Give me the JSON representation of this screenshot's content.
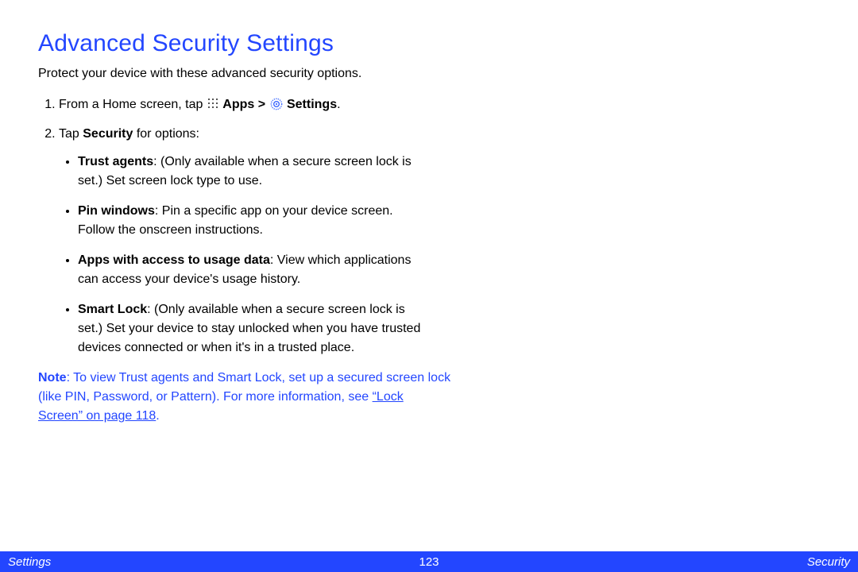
{
  "title": "Advanced Security Settings",
  "intro": "Protect your device with these advanced security options.",
  "step1": {
    "prefix": "From a Home screen, tap ",
    "apps_label": "Apps",
    "sep": " > ",
    "settings_label": "Settings",
    "suffix": "."
  },
  "step2": {
    "prefix": "Tap ",
    "bold": "Security",
    "suffix": " for options:",
    "items": [
      {
        "label": "Trust agents",
        "desc": ": (Only available when a secure screen lock is set.) Set screen lock type to use."
      },
      {
        "label": "Pin windows",
        "desc": ": Pin a specific app on your device screen. Follow the onscreen instructions."
      },
      {
        "label": "Apps with access to usage data",
        "desc": ": View which applications can access your device's usage history."
      },
      {
        "label": "Smart Lock",
        "desc": ": (Only available when a secure screen lock is set.) Set your device to stay unlocked when you have trusted devices connected or when it's in a trusted place."
      }
    ]
  },
  "note": {
    "label": "Note",
    "body_prefix": ": To view Trust agents and Smart Lock, set up a secured screen lock (like PIN, Password, or Pattern). For more information, see ",
    "link": "“Lock Screen” on page 118",
    "body_suffix": "."
  },
  "footer": {
    "left": "Settings",
    "center": "123",
    "right": "Security"
  }
}
